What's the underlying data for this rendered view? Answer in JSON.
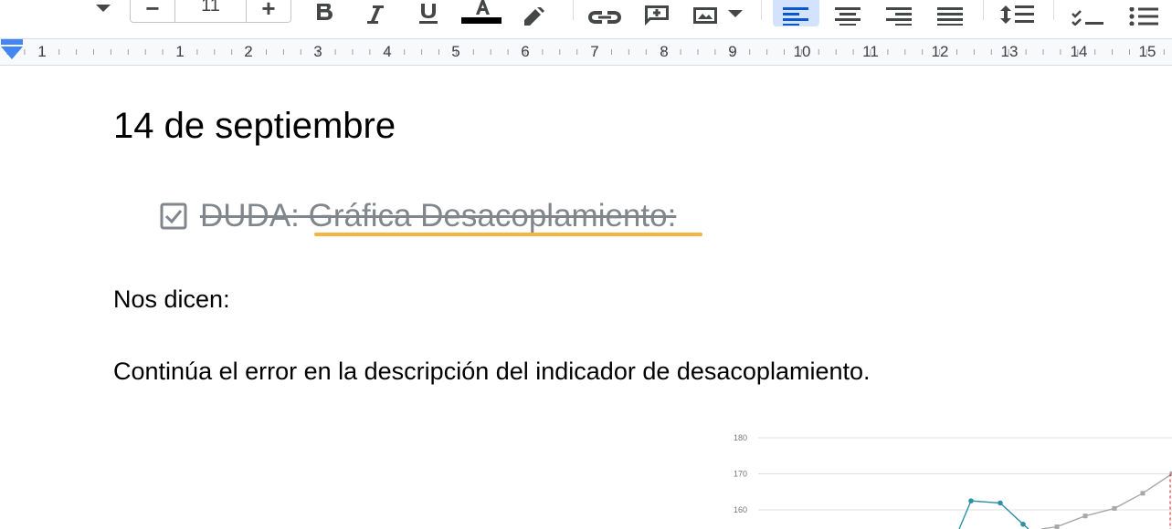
{
  "toolbar": {
    "font_size": "11",
    "font_size_decrease_label": "−",
    "font_size_increase_label": "+",
    "icons": [
      "dropdown-arrow-icon",
      "bold-icon",
      "italic-icon",
      "underline-icon",
      "text-color-icon",
      "highlight-icon",
      "link-icon",
      "add-comment-icon",
      "insert-image-icon",
      "align-left-icon",
      "align-center-icon",
      "align-right-icon",
      "align-justify-icon",
      "line-spacing-icon",
      "checklist-icon",
      "bulleted-list-icon"
    ],
    "text_color": "#000000",
    "active_alignment": "left",
    "active_bg": "#d3e3fd",
    "active_icon_color": "#0b57d0"
  },
  "ruler": {
    "numbers": [
      "1",
      "1",
      "2",
      "3",
      "4",
      "5",
      "6",
      "7",
      "8",
      "9",
      "10",
      "11",
      "12",
      "13",
      "14",
      "15"
    ],
    "marker_color": "#4285f4"
  },
  "document": {
    "heading": "14 de septiembre",
    "checklist_item": {
      "checked": true,
      "text": "DUDA: Gráfica Desacoplamiento:",
      "spell_underline_color": "#f5b342"
    },
    "paragraphs": [
      "Nos dicen:",
      "Continúa el error en la descripción del indicador de desacoplamiento."
    ]
  },
  "chart_data": {
    "type": "line",
    "yticks": [
      "180",
      "170",
      "160"
    ],
    "ylim": [
      150,
      180
    ],
    "series": [
      {
        "color": "#2e8fa6",
        "x": [
          1,
          2,
          3
        ],
        "y": [
          162.5,
          161.9,
          156
        ]
      },
      {
        "color": "#a8a8a8",
        "x": [
          4,
          5,
          6,
          7,
          8
        ],
        "y": [
          155.3,
          158.3,
          160.4,
          164.6,
          170
        ]
      }
    ],
    "marker_line_color": "#e53935"
  }
}
